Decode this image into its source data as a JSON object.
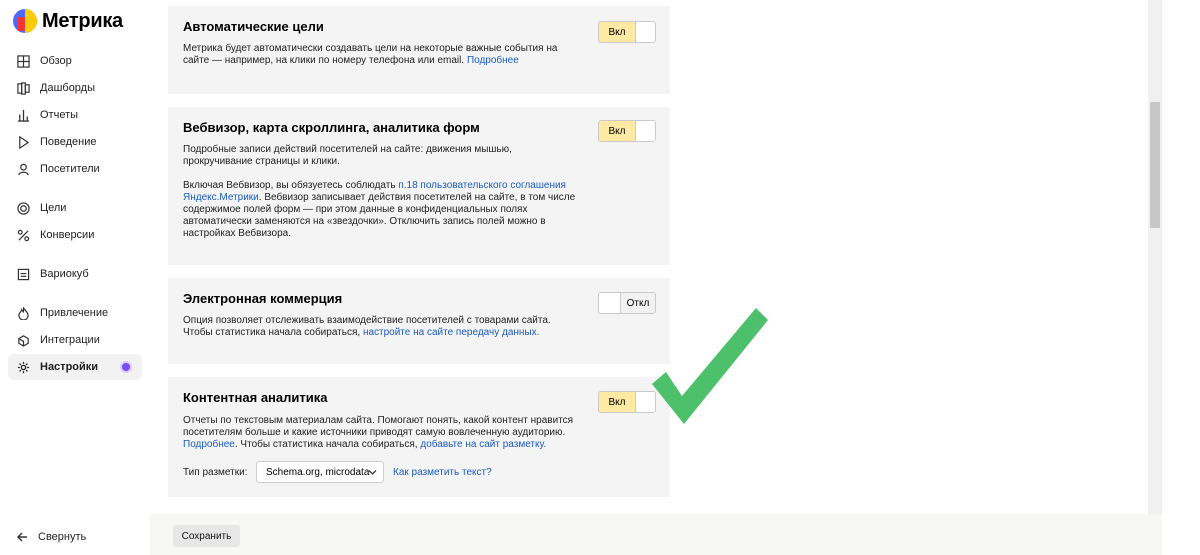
{
  "app": {
    "title": "Метрика"
  },
  "sidebar": {
    "items": [
      {
        "label": "Обзор",
        "icon": "grid-icon"
      },
      {
        "label": "Дашборды",
        "icon": "dashboards-icon"
      },
      {
        "label": "Отчеты",
        "icon": "reports-icon"
      },
      {
        "label": "Поведение",
        "icon": "play-icon"
      },
      {
        "label": "Посетители",
        "icon": "person-icon"
      },
      {
        "label": "Цели",
        "icon": "target-icon"
      },
      {
        "label": "Конверсии",
        "icon": "percent-icon"
      },
      {
        "label": "Вариокуб",
        "icon": "variocube-icon"
      },
      {
        "label": "Привлечение",
        "icon": "flame-icon"
      },
      {
        "label": "Интеграции",
        "icon": "integrations-icon"
      },
      {
        "label": "Настройки",
        "icon": "gear-icon",
        "active": true
      }
    ],
    "collapse_label": "Свернуть"
  },
  "cards": {
    "auto_goals": {
      "title": "Автоматические цели",
      "text1": "Метрика будет автоматически создавать цели на некоторые важные события на",
      "text2": "сайте — например, на клики по номеру телефона или email. ",
      "link": "Подробнее",
      "toggle": "Вкл"
    },
    "webvisor": {
      "title": "Вебвизор, карта скроллинга, аналитика форм",
      "text1": "Подробные записи действий посетителей на сайте: движения мышью,",
      "text2": "прокручивание страницы и клики.",
      "text3_pre": "Включая Вебвизор, вы обязуетесь соблюдать ",
      "text3_link": "п.18 пользовательского соглашения",
      "text4_link": "Яндекс.Метрики",
      "text4_post": ". Вебвизор записывает действия посетителей на сайте, в том числе",
      "text5": "содержимое полей форм — при этом данные в конфиденциальных полях",
      "text6": "автоматически заменяются на «звездочки». Отключить запись полей можно в",
      "text7": "настройках Вебвизора.",
      "toggle": "Вкл"
    },
    "ecommerce": {
      "title": "Электронная коммерция",
      "text1": "Опция позволяет отслеживать взаимодействие посетителей с товарами сайта.",
      "text2_pre": "Чтобы статистика начала собираться, ",
      "text2_link": "настройте на сайте передачу данных.",
      "toggle": "Откл"
    },
    "content": {
      "title": "Контентная аналитика",
      "text1": "Отчеты по текстовым материалам сайта. Помогают понять, какой контент нравится",
      "text2": "посетителям больше и какие источники приводят самую вовлеченную аудиторию.",
      "text3_link1": "Подробнее",
      "text3_mid": ". Чтобы статистика начала собираться, ",
      "text3_link2": "добавьте на сайт разметку.",
      "toggle": "Вкл",
      "markup_label": "Тип разметки:",
      "markup_value": "Schema.org, microdata",
      "markup_help": "Как разметить текст?"
    }
  },
  "footer": {
    "save_label": "Сохранить"
  },
  "colors": {
    "toggle_on": "#ffe9a3",
    "link": "#1a5bbf",
    "checkmark": "#4cc06a",
    "active_dot": "#7b4ef5"
  }
}
